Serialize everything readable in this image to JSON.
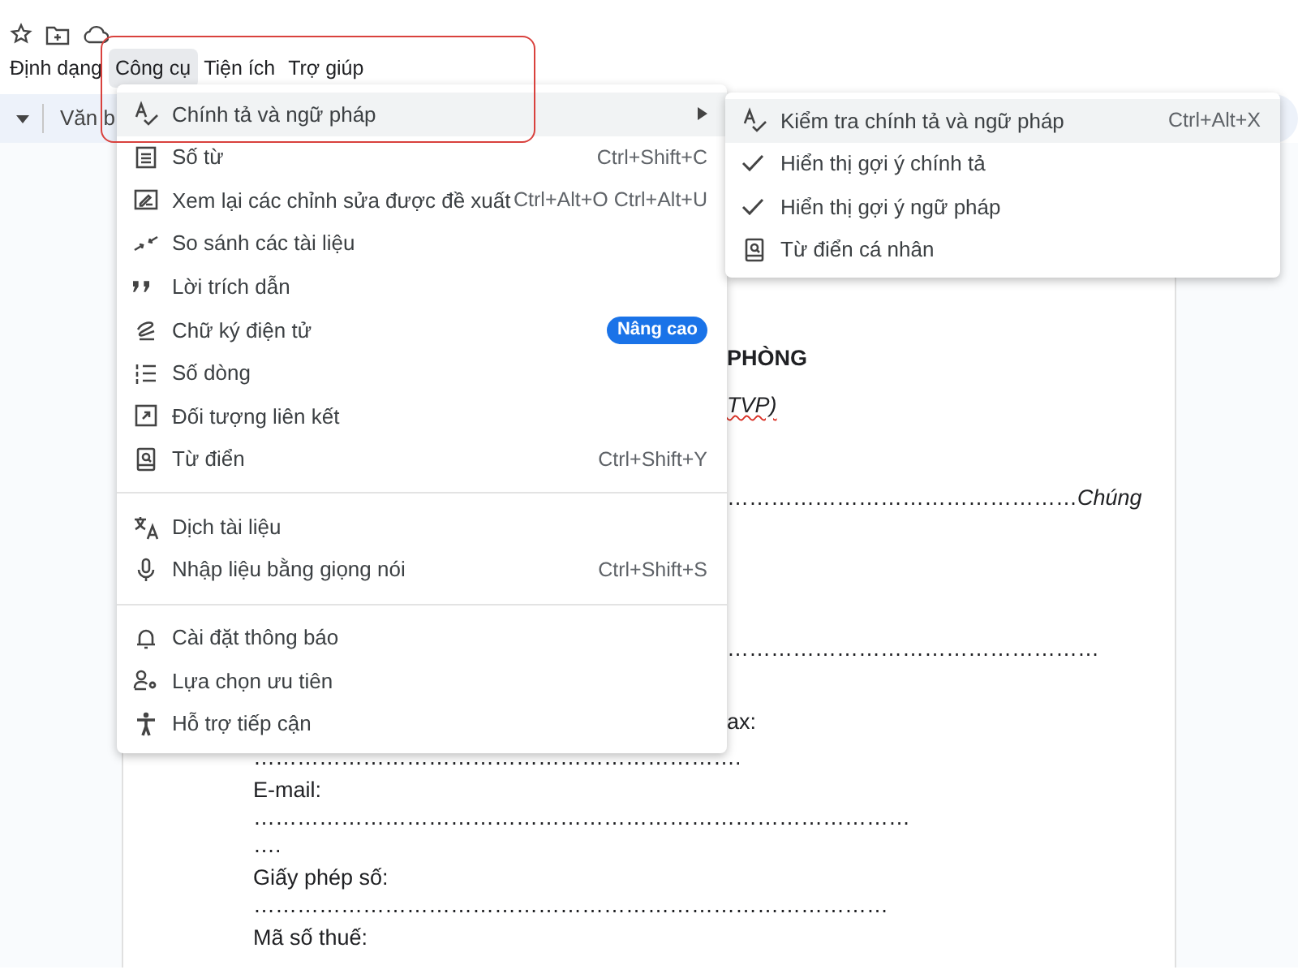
{
  "menubar": [
    {
      "label": "Định dạng",
      "selected": false
    },
    {
      "label": "Công cụ",
      "selected": true
    },
    {
      "label": "Tiện ích",
      "selected": false
    },
    {
      "label": "Trợ giúp",
      "selected": false
    }
  ],
  "toolbar": {
    "style_label": "Văn b"
  },
  "tools_menu": {
    "groups": [
      [
        {
          "label": "Chính tả và ngữ pháp",
          "selected": true,
          "has_submenu": true
        },
        {
          "label": "Số từ",
          "shortcut": "Ctrl+Shift+C",
          "selected": false
        },
        {
          "label": "Xem lại các chỉnh sửa được đề xuất",
          "shortcut": "Ctrl+Alt+O Ctrl+Alt+U",
          "selected": false
        },
        {
          "label": "So sánh các tài liệu",
          "selected": false
        },
        {
          "label": "Lời trích dẫn",
          "selected": false
        },
        {
          "label": "Chữ ký điện tử",
          "badge": "Nâng cao",
          "selected": false
        },
        {
          "label": "Số dòng",
          "selected": false
        },
        {
          "label": "Đối tượng liên kết",
          "selected": false
        },
        {
          "label": "Từ điển",
          "shortcut": "Ctrl+Shift+Y",
          "selected": false
        }
      ],
      [
        {
          "label": "Dịch tài liệu",
          "selected": false
        },
        {
          "label": "Nhập liệu bằng giọng nói",
          "shortcut": "Ctrl+Shift+S",
          "selected": false
        }
      ],
      [
        {
          "label": "Cài đặt thông báo",
          "selected": false
        },
        {
          "label": "Lựa chọn ưu tiên",
          "selected": false
        },
        {
          "label": "Hỗ trợ tiếp cận",
          "selected": false
        }
      ]
    ]
  },
  "submenu": [
    {
      "kind": "action",
      "label": "Kiểm tra chính tả và ngữ pháp",
      "shortcut": "Ctrl+Alt+X",
      "selected": true
    },
    {
      "kind": "toggle",
      "label": "Hiển thị gợi ý chính tả",
      "checked": true,
      "selected": false
    },
    {
      "kind": "toggle",
      "label": "Hiển thị gợi ý ngữ pháp",
      "checked": true,
      "selected": false
    },
    {
      "kind": "action",
      "label": "Từ điển cá nhân",
      "selected": false
    }
  ],
  "document": [
    {
      "kind": "heading",
      "text": "PHÒNG"
    },
    {
      "kind": "subtitle",
      "text": "TVP)",
      "spelling_error": true
    },
    {
      "kind": "line_right",
      "text": "…………………………………………*Chúng*"
    },
    {
      "kind": "line_right",
      "text": "……………………………………………"
    },
    {
      "kind": "line_right",
      "text": "ax:"
    },
    {
      "kind": "line",
      "text": "…………………………………………………………."
    },
    {
      "kind": "label",
      "text": "E-mail:"
    },
    {
      "kind": "line",
      "text": "………………………………………………………………………………"
    },
    {
      "kind": "line",
      "text": "…."
    },
    {
      "kind": "label",
      "text": "Giấy phép số:"
    },
    {
      "kind": "line",
      "text": "……………………………………………………………………………"
    },
    {
      "kind": "label",
      "text": "Mã số thuế:"
    }
  ]
}
